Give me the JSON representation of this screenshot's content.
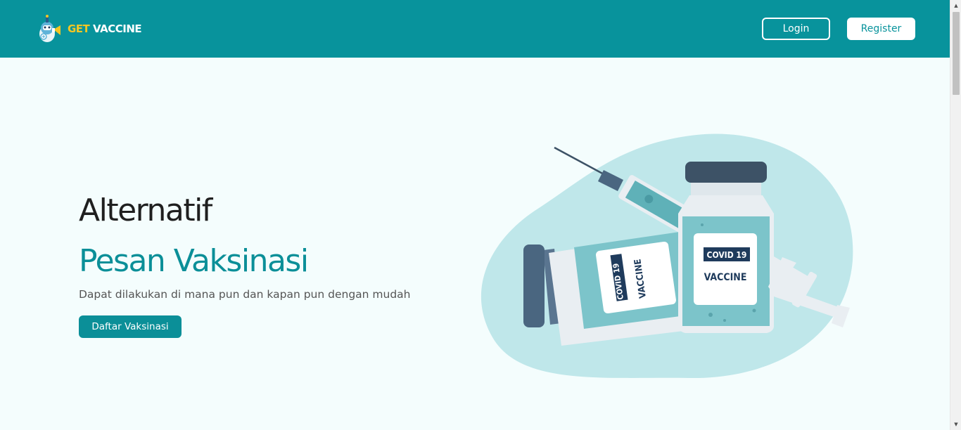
{
  "brand": {
    "logo_get": "GET",
    "logo_vaccine": "VACCINE"
  },
  "nav": {
    "login_label": "Login",
    "register_label": "Register"
  },
  "hero": {
    "title": "Alternatif",
    "subtitle": "Pesan Vaksinasi",
    "description": "Dapat dilakukan di mana pun dan kapan pun dengan mudah",
    "cta_label": "Daftar Vaksinasi"
  },
  "illustration": {
    "label_left_top": "COVID 19",
    "label_left_bottom": "VACCINE",
    "label_right_top": "COVID 19",
    "label_right_bottom": "VACCINE"
  },
  "colors": {
    "primary": "#08939c",
    "accent": "#f3c623",
    "title": "#1f1f1f",
    "background": "#f4fdfd"
  }
}
